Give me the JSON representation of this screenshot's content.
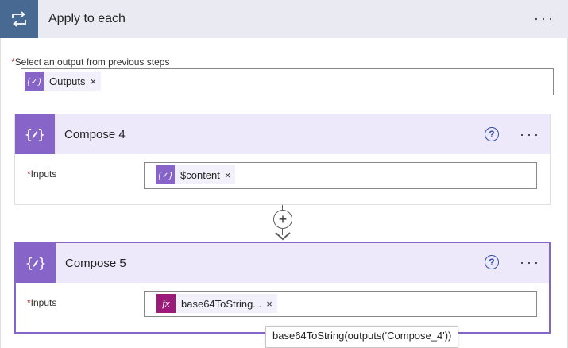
{
  "apply_to_each": {
    "title": "Apply to each",
    "more_label": "···",
    "select_label": "Select an output from previous steps",
    "required_mark": "*",
    "token": {
      "text": "Outputs",
      "remove": "×",
      "icon": "expression-curly-icon"
    }
  },
  "compose4": {
    "title": "Compose 4",
    "help": "?",
    "more_label": "···",
    "inputs_label": "Inputs",
    "token": {
      "text": "$content",
      "remove": "×",
      "icon": "expression-curly-icon"
    }
  },
  "connector": {
    "add_symbol": "+"
  },
  "compose5": {
    "title": "Compose 5",
    "help": "?",
    "more_label": "···",
    "inputs_label": "Inputs",
    "token": {
      "text": "base64ToString...",
      "remove": "×",
      "icon": "fx-icon",
      "icon_label": "fx"
    }
  },
  "tooltip": {
    "text": "base64ToString(outputs('Compose_4'))"
  },
  "colors": {
    "loop_header": "#486991",
    "compose_accent": "#8764c8",
    "fx_token": "#9c1b7a",
    "selected_border": "#8764c8"
  }
}
